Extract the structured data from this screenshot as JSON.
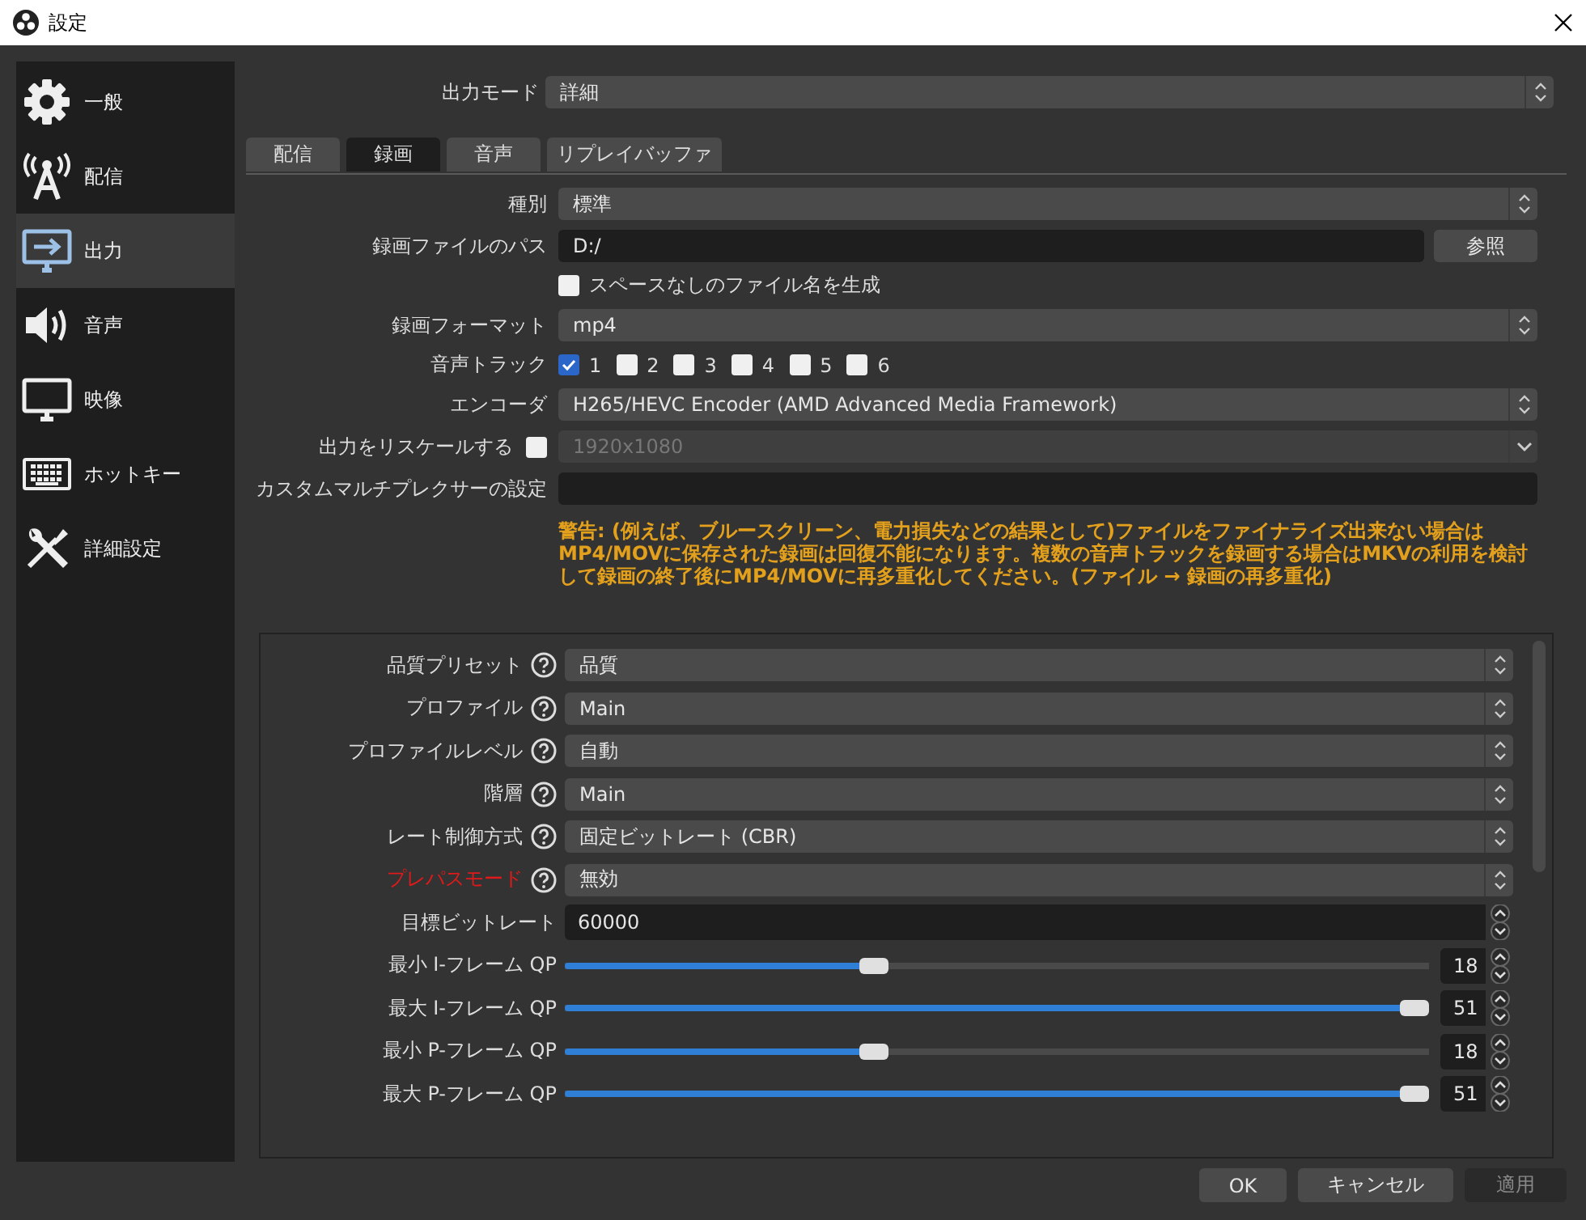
{
  "window": {
    "title": "設定"
  },
  "sidebar": {
    "items": [
      {
        "label": "一般",
        "selected": false
      },
      {
        "label": "配信",
        "selected": false
      },
      {
        "label": "出力",
        "selected": true
      },
      {
        "label": "音声",
        "selected": false
      },
      {
        "label": "映像",
        "selected": false
      },
      {
        "label": "ホットキー",
        "selected": false
      },
      {
        "label": "詳細設定",
        "selected": false
      }
    ]
  },
  "output_mode": {
    "label": "出力モード",
    "value": "詳細"
  },
  "tabs": [
    {
      "label": "配信",
      "selected": false
    },
    {
      "label": "録画",
      "selected": true
    },
    {
      "label": "音声",
      "selected": false
    },
    {
      "label": "リプレイバッファ",
      "selected": false
    }
  ],
  "recording": {
    "rows": [
      {
        "kind": "combo",
        "label": "種別",
        "value": "標準"
      },
      {
        "kind": "path",
        "label": "録画ファイルのパス",
        "value": "D:/",
        "button": "参照"
      },
      {
        "kind": "checkbox",
        "label": "スペースなしのファイル名を生成",
        "checked": false
      },
      {
        "kind": "combo",
        "label": "録画フォーマット",
        "value": "mp4"
      },
      {
        "kind": "tracks",
        "label": "音声トラック",
        "tracks": [
          {
            "label": "1",
            "checked": true
          },
          {
            "label": "2",
            "checked": false
          },
          {
            "label": "3",
            "checked": false
          },
          {
            "label": "4",
            "checked": false
          },
          {
            "label": "5",
            "checked": false
          },
          {
            "label": "6",
            "checked": false
          }
        ]
      },
      {
        "kind": "combo",
        "label": "エンコーダ",
        "value": "H265/HEVC Encoder (AMD Advanced Media Framework)"
      },
      {
        "kind": "rescale",
        "label": "出力をリスケールする",
        "checked": false,
        "value": "1920x1080",
        "disabled": true
      },
      {
        "kind": "text",
        "label": "カスタムマルチプレクサーの設定"
      }
    ],
    "warning": "警告: (例えば、ブルースクリーン、電力損失などの結果として)ファイルをファイナライズ出来ない場合はMP4/MOVに保存された録画は回復不能になります。複数の音声トラックを録画する場合はMKVの利用を検討して録画の終了後にMP4/MOVに再多重化してください。(ファイル → 録画の再多重化)"
  },
  "encoder": {
    "rows": [
      {
        "kind": "combo",
        "label": "品質プリセット",
        "value": "品質",
        "help": true,
        "warning": false
      },
      {
        "kind": "combo",
        "label": "プロファイル",
        "value": "Main",
        "help": true,
        "warning": false
      },
      {
        "kind": "combo",
        "label": "プロファイルレベル",
        "value": "自動",
        "help": true,
        "warning": false
      },
      {
        "kind": "combo",
        "label": "階層",
        "value": "Main",
        "help": true,
        "warning": false
      },
      {
        "kind": "combo",
        "label": "レート制御方式",
        "value": "固定ビットレート (CBR)",
        "help": true,
        "warning": false
      },
      {
        "kind": "combo",
        "label": "プレパスモード",
        "value": "無効",
        "help": true,
        "warning": true
      },
      {
        "kind": "spin",
        "label": "目標ビットレート",
        "value": "60000",
        "help": false,
        "warning": false
      },
      {
        "kind": "slider",
        "label": "最小 I-フレーム QP",
        "value": "18",
        "level": 0.353,
        "help": false,
        "warning": false
      },
      {
        "kind": "slider",
        "label": "最大 I-フレーム QP",
        "value": "51",
        "level": 1,
        "help": false,
        "warning": false
      },
      {
        "kind": "slider",
        "label": "最小 P-フレーム QP",
        "value": "18",
        "level": 0.353,
        "help": false,
        "warning": false
      },
      {
        "kind": "slider",
        "label": "最大 P-フレーム QP",
        "value": "51",
        "level": 1,
        "help": false,
        "warning": false
      }
    ]
  },
  "buttons": [
    {
      "label": "OK",
      "disabled": false
    },
    {
      "label": "キャンセル",
      "disabled": false
    },
    {
      "label": "適用",
      "disabled": true
    }
  ]
}
